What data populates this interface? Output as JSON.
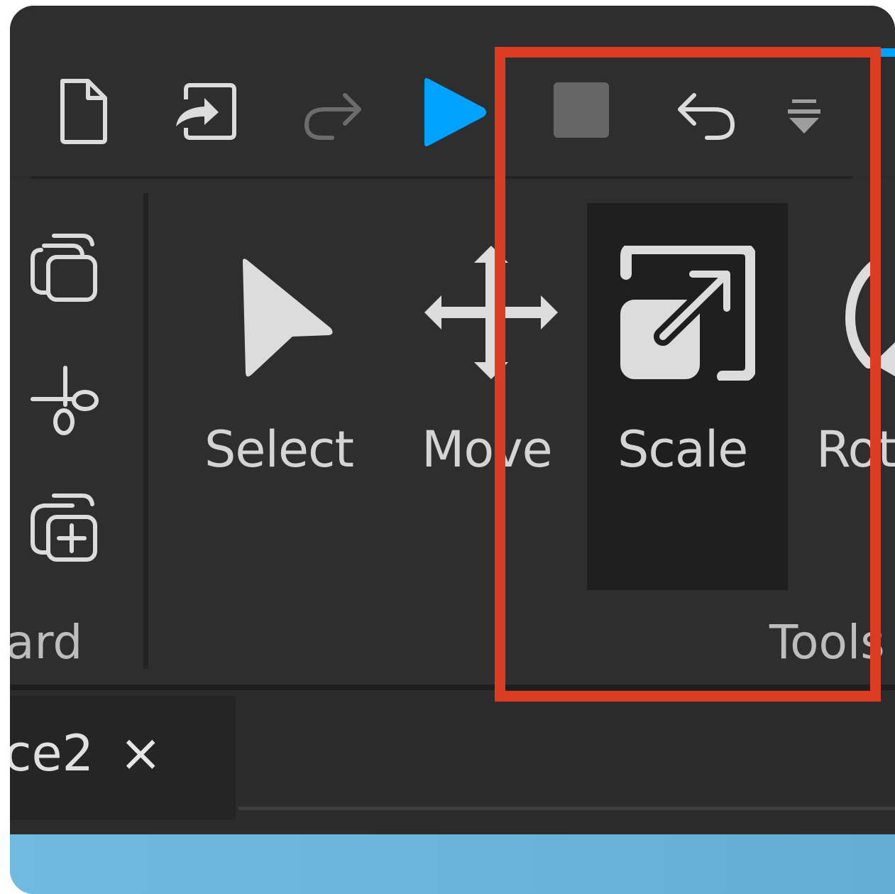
{
  "quick_access": {
    "new_file_icon": "new-file-icon",
    "publish_icon": "publish-icon",
    "redo_icon": "redo-icon",
    "play_icon": "play-icon",
    "stop_icon": "stop-icon",
    "undo_icon": "undo-icon",
    "customize_icon": "customize-dropdown-icon",
    "accent_color": "#00a2ff"
  },
  "clipboard": {
    "group_label": "ard",
    "copy_icon": "copy-icon",
    "cut_icon": "cut-icon",
    "duplicate_icon": "duplicate-icon"
  },
  "tools": {
    "group_label": "Tools",
    "select_label": "Select",
    "move_label": "Move",
    "scale_label": "Scale",
    "rotate_label": "Rot",
    "active_tool": "Scale"
  },
  "tabs": [
    {
      "label": "ce2",
      "close": "×"
    }
  ],
  "highlight_color": "#dc3c22"
}
